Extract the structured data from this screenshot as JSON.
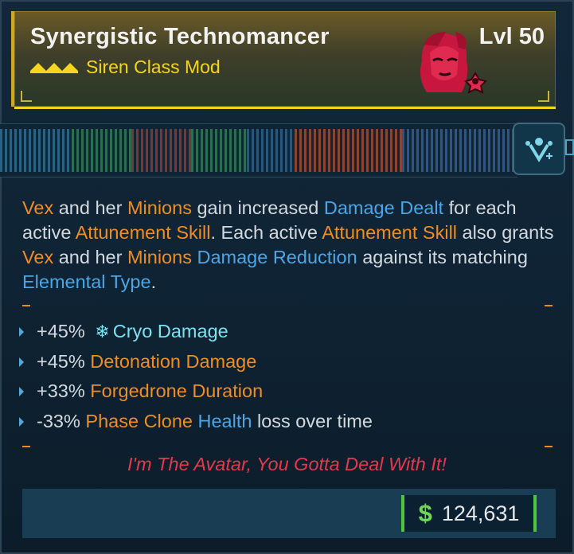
{
  "item": {
    "name": "Synergistic Technomancer",
    "level": "Lvl 50",
    "class_mod": "Siren Class Mod",
    "rarity_icon": "legendary-chevrons-icon",
    "portrait_icon": "siren-vex-portrait-icon",
    "skill_icon": "minion-skill-icon"
  },
  "description": {
    "p1": "Vex",
    "p2": " and her ",
    "p3": "Minions",
    "p4": " gain increased ",
    "p5": "Damage Dealt",
    "p6": " for each active ",
    "p7": "Attunement Skill",
    "p8": ". Each active ",
    "p9": "Attunement Skill",
    "p10": " also grants ",
    "p11": "Vex",
    "p12": " and her ",
    "p13": "Minions",
    "p14": " ",
    "p15": "Damage Reduction",
    "p16": " against its matching ",
    "p17": "Elemental Type",
    "p18": "."
  },
  "stats": [
    {
      "value": "+45%",
      "label": "Cryo Damage",
      "icon": "snowflake-icon"
    },
    {
      "value": "+45%",
      "label": "Detonation Damage"
    },
    {
      "value": "+33%",
      "label": "Forgedrone Duration"
    },
    {
      "value": "-33%",
      "label_a": "Phase Clone",
      "label_b": "Health",
      "label_c": "loss over time"
    }
  ],
  "flavor_text": "I'm The Avatar, You Gotta Deal With It!",
  "price": {
    "currency": "$",
    "amount": "124,631"
  },
  "colors": {
    "legendary": "#f7d51e",
    "orange_keyword": "#f08d22",
    "blue_keyword": "#4aa6e6",
    "cryo": "#79e3ef",
    "flavor": "#e5384e",
    "money": "#4fc43e"
  }
}
